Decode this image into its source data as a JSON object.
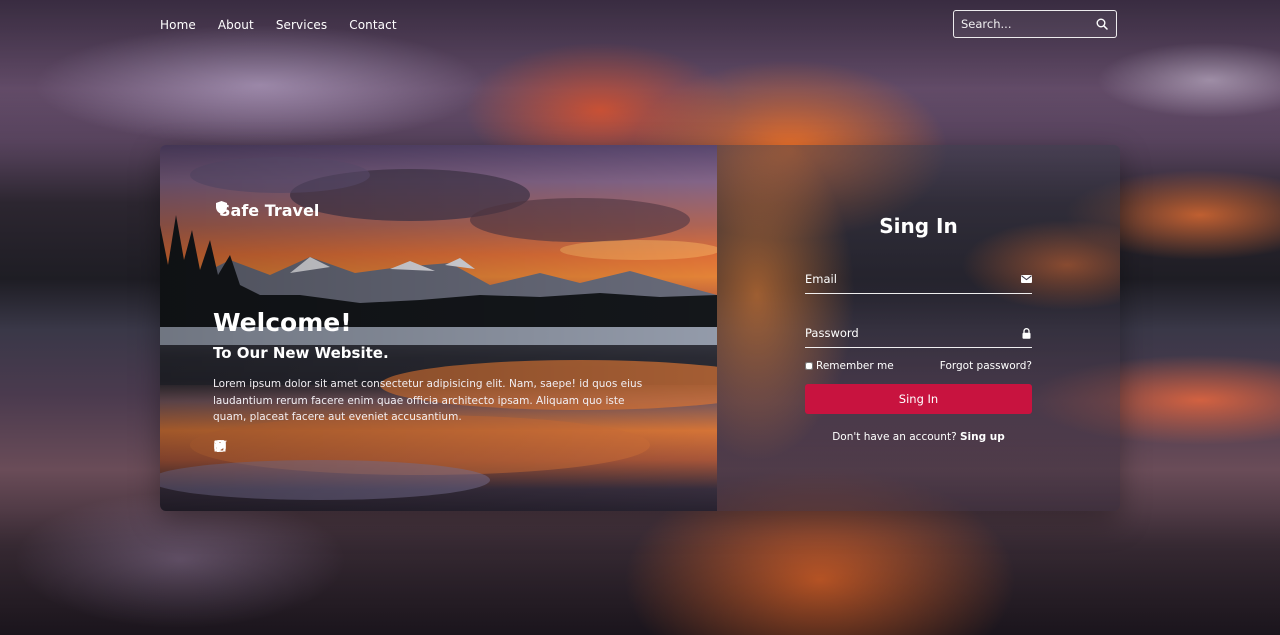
{
  "nav": {
    "links": [
      "Home",
      "About",
      "Services",
      "Contact"
    ],
    "search_placeholder": "Search...",
    "search_icon": "search-icon"
  },
  "hero": {
    "brand": "Safe Travel",
    "brand_icon": "shield-icon",
    "title": "Welcome!",
    "subtitle": "To Our New Website.",
    "description": "Lorem ipsum dolor sit amet consectetur adipisicing elit. Nam, saepe! id quos eius laudantium rerum facere enim quae officia architecto ipsam. Aliquam quo iste quam, placeat facere aut eveniet accusantium.",
    "socials": [
      "linkedin-icon",
      "facebook-icon",
      "instagram-icon",
      "twitter-icon"
    ]
  },
  "signin": {
    "title": "Sing In",
    "email_placeholder": "Email",
    "email_icon": "envelope-icon",
    "password_placeholder": "Password",
    "password_icon": "lock-icon",
    "remember_label": "Remember me",
    "forgot_label": "Forgot password?",
    "button_label": "Sing In",
    "no_account_text": "Don't have an account?",
    "signup_link": "Sing up"
  },
  "colors": {
    "accent": "#c8133f",
    "text": "#ffffff"
  }
}
